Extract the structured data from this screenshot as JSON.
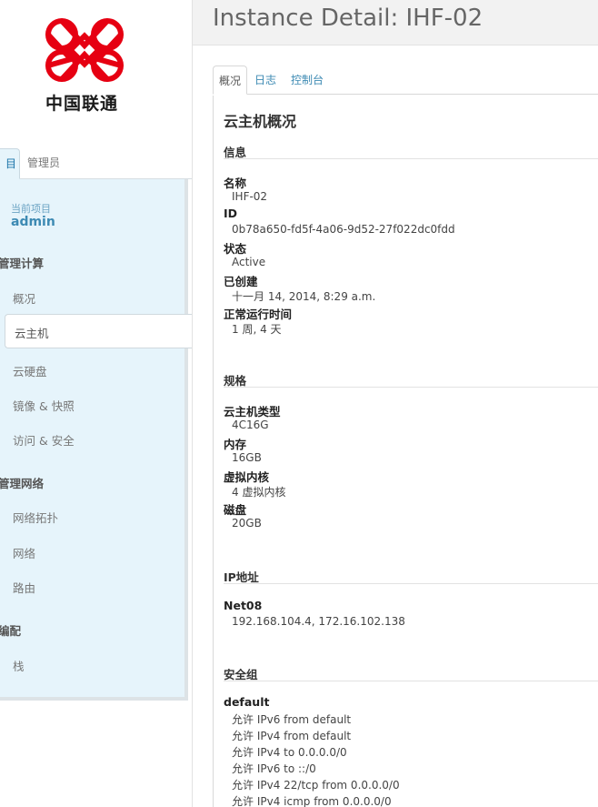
{
  "brand": {
    "logo_text": "中国联通",
    "logo_color": "#e60012"
  },
  "sidebar": {
    "tabs": [
      {
        "label": "项目"
      },
      {
        "label": "管理员"
      }
    ],
    "project_tab_visible": "目",
    "current_project_label": "当前项目",
    "current_project_name": "admin",
    "groups": [
      {
        "label": "管理计算",
        "visible": "管理计算"
      },
      {
        "label": "管理网络",
        "visible": "管理网络"
      },
      {
        "label": "编配",
        "visible": "编配"
      }
    ],
    "items": [
      {
        "label": "概况"
      },
      {
        "label": "云主机",
        "active": true
      },
      {
        "label": "云硬盘"
      },
      {
        "label": "镜像 & 快照"
      },
      {
        "label": "访问 & 安全"
      },
      {
        "label": "网络拓扑"
      },
      {
        "label": "网络"
      },
      {
        "label": "路由"
      },
      {
        "label": "栈"
      }
    ]
  },
  "page_title": "Instance Detail: IHF-02",
  "tabs": [
    {
      "label": "概况",
      "active": true
    },
    {
      "label": "日志"
    },
    {
      "label": "控制台"
    }
  ],
  "detail": {
    "title": "云主机概况",
    "info": {
      "heading": "信息",
      "fields": [
        {
          "label": "名称",
          "value": "IHF-02"
        },
        {
          "label": "ID",
          "value": "0b78a650-fd5f-4a06-9d52-27f022dc0fdd"
        },
        {
          "label": "状态",
          "value": "Active"
        },
        {
          "label": "已创建",
          "value": "十一月 14, 2014, 8:29 a.m."
        },
        {
          "label": "正常运行时间",
          "value": "1 周, 4 天"
        }
      ]
    },
    "specs": {
      "heading": "规格",
      "fields": [
        {
          "label": "云主机类型",
          "value": "4C16G"
        },
        {
          "label": "内存",
          "value": "16GB"
        },
        {
          "label": "虚拟内核",
          "value": "4 虚拟内核"
        },
        {
          "label": "磁盘",
          "value": "20GB"
        }
      ]
    },
    "ip": {
      "heading": "IP地址",
      "network": "Net08",
      "addresses": "192.168.104.4,  172.16.102.138"
    },
    "security": {
      "heading": "安全组",
      "group": "default",
      "rules": [
        "允许 IPv6 from default",
        "允许 IPv4 from default",
        "允许 IPv4 to 0.0.0.0/0",
        "允许 IPv6 to ::/0",
        "允许 IPv4 22/tcp from 0.0.0.0/0",
        "允许 IPv4 icmp from 0.0.0.0/0"
      ]
    }
  }
}
